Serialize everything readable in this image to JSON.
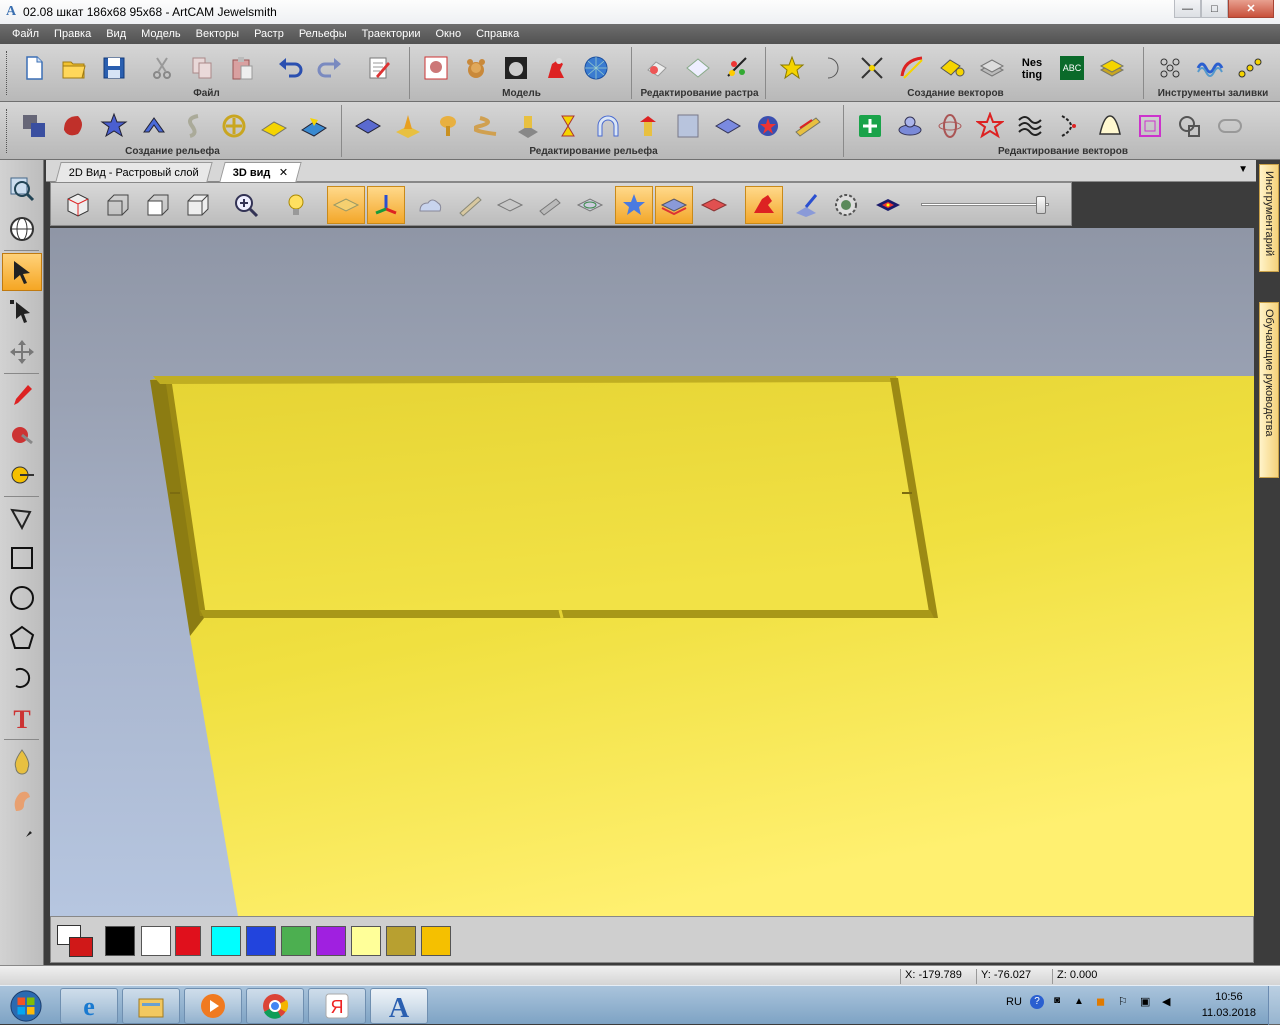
{
  "window": {
    "title": "02.08 шкат 186x68 95x68 - ArtCAM Jewelsmith",
    "icon": "artcam-logo",
    "min": "—",
    "max": "□",
    "close": "✕"
  },
  "menu": [
    "Файл",
    "Правка",
    "Вид",
    "Модель",
    "Векторы",
    "Растр",
    "Рельефы",
    "Траектории",
    "Окно",
    "Справка"
  ],
  "toolbar_groups_row1": {
    "file": "Файл",
    "model": "Модель",
    "raster_edit": "Редактирование растра",
    "vector_create": "Создание векторов",
    "fill_tools": "Инструменты заливки"
  },
  "toolbar_groups_row2": {
    "relief_create": "Создание рельефа",
    "relief_edit": "Редактирование рельефа",
    "vector_edit": "Редактирование векторов"
  },
  "nesting_label": "Nes ting",
  "tabs": [
    {
      "label": "2D Вид - Растровый слой",
      "active": false
    },
    {
      "label": "3D вид",
      "active": true,
      "close": "✕"
    }
  ],
  "right_panel_tabs": [
    "Инструментарий",
    "Обучающие руководства"
  ],
  "palette_colors": [
    "#000000",
    "#ffffff",
    "#e0101c",
    "#00ffff",
    "#2244dd",
    "#4caf50",
    "#a020e0",
    "#ffff99",
    "#b8a030",
    "#f5c000"
  ],
  "status": {
    "x": "X: -179.789",
    "y": "Y: -76.027",
    "z": "Z: 0.000"
  },
  "taskbar": {
    "lang": "RU",
    "time": "10:56",
    "date": "11.03.2018"
  },
  "colors": {
    "accent": "#f5a623",
    "relief": "#e8d640",
    "menubar": "#5f5f5f"
  }
}
